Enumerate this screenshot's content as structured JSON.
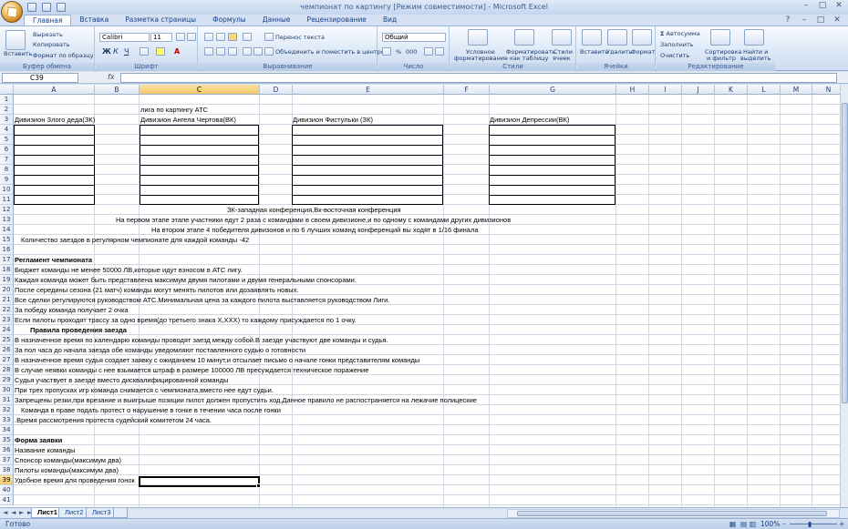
{
  "window": {
    "title": "чемпионат по картингу  [Режим совместимости] - Microsoft Excel"
  },
  "tabs": [
    "Главная",
    "Вставка",
    "Разметка страницы",
    "Формулы",
    "Данные",
    "Рецензирование",
    "Вид"
  ],
  "ribbon": {
    "paste": "Вставить",
    "cut": "Вырезать",
    "copy": "Копировать",
    "format_painter": "Формат по образцу",
    "clipboard": "Буфер обмена",
    "font_name": "Calibri",
    "font_size": "11",
    "font": "Шрифт",
    "wrap": "Перенос текста",
    "merge": "Объединить и поместить в центре",
    "alignment": "Выравнивание",
    "number_format": "Общий",
    "number": "Число",
    "cond1": "Условное",
    "cond2": "форматирование",
    "fmt_table1": "Форматировать",
    "fmt_table2": "как таблицу",
    "cell_styles1": "Стили",
    "cell_styles2": "ячеек",
    "styles": "Стили",
    "insert": "Вставить",
    "delete": "Удалить",
    "format": "Формат",
    "cells": "Ячейки",
    "autosum": "Автосумма",
    "fill": "Заполнить",
    "clear": "Очистить",
    "sort1": "Сортировка",
    "sort2": "и фильтр",
    "find1": "Найти и",
    "find2": "выделить",
    "editing": "Редактирование"
  },
  "formula_bar": {
    "name_box": "C39",
    "fx": "fx",
    "formula": ""
  },
  "columns": [
    "A",
    "B",
    "C",
    "D",
    "E",
    "F",
    "G",
    "H",
    "I",
    "J",
    "K",
    "L",
    "M",
    "N"
  ],
  "rows": [
    "1",
    "2",
    "3",
    "4",
    "5",
    "6",
    "7",
    "8",
    "9",
    "10",
    "11",
    "12",
    "13",
    "14",
    "15",
    "16",
    "17",
    "18",
    "19",
    "20",
    "21",
    "22",
    "23",
    "24",
    "25",
    "26",
    "27",
    "28",
    "29",
    "30",
    "31",
    "32",
    "33",
    "34",
    "35",
    "36",
    "37",
    "38",
    "39",
    "40",
    "41"
  ],
  "cells": {
    "r2": "лига по картингу  АТС",
    "r3a": "Дивизион Злого деда(ЗК)",
    "r3c": "Дивизион Ангела Чертова(ВК)",
    "r3e": "Дивизион Фистульки (ЗК)",
    "r3g": "Дивизион Депрессии(ВК)",
    "r12": "ЗК-западная конференция,Вк-восточная конференция",
    "r13": "На первом этапе этапе участники едут 2 раза с командами в своем дивизионе,и по одному с командами других дивизионов",
    "r14": "На втором этапе 4 победителя дивизонов и по 6 лучших команд конференций вы ходят в 1/16 финала",
    "r15": "Количество заездов в регулярном чемпионате для каждой команды -42",
    "r17": "Регламент чемпионата",
    "r18": "Бюджет команды не менее 50000 ЛВ,которые идут взносом в АТС лигу.",
    "r19": "Каждая команда может быть представлена максимум двумя пилотами и двумя генеральными спонсорами.",
    "r20": "После середины сезона (21 матч) команды могут менять пилотов или дозаявлять новых.",
    "r21": "Все сделки  регулируются руководством АТС.Минимальная цена за каждого пилота выставляется руководством Лиги.",
    "r22": "За победу команда получает 2 очка",
    "r23": "Если пилоты проходят трассу за одно время(до третьего знака X,XXX) то каждому присуждается по 1 очку.",
    "r24": "Правила проведения заезда",
    "r25": "В назначенное время по календарю команды проводят заезд между собой.В заезде участвуют две команды и судья.",
    "r26": "За пол часа до начала заезда обе команды уведомляют поставленного судью о готовности",
    "r27": "В назначенное время судья создает заявку с ожиданием 10 минут,и отсылает письмо о начале гонки представителям команды",
    "r28": "В случае неявки команды с нее взымается штраф в размере 100000 ЛВ пресуждается техническое поражение",
    "r29": "Судья участвует в заезде вместо дисквалифицированной команды",
    "r30": "При трех пропусках игр команда снимается с чемпионата,вместо нее едут судьи.",
    "r31": "Запрещены резки,при врезание и выигрыше позиции пилот должен пропустить ход.Данное правило не распостраняется на лежачие полицеские",
    "r32": "Команда в праве подать протест о нарушение в гонке в течении часа после гонки",
    "r33": ".Время рассмотрения протеста судейский комитетом 24 часа.",
    "r35": "Форма заявки",
    "r36": "Название команды",
    "r37": "Спонсор команды(максимум два)",
    "r38": "Пилоты команды(максимум два)",
    "r39": "Удобное время для проведения гонок"
  },
  "sheets": [
    "Лист1",
    "Лист2",
    "Лист3"
  ],
  "status": {
    "ready": "Готово",
    "zoom": "100%"
  }
}
